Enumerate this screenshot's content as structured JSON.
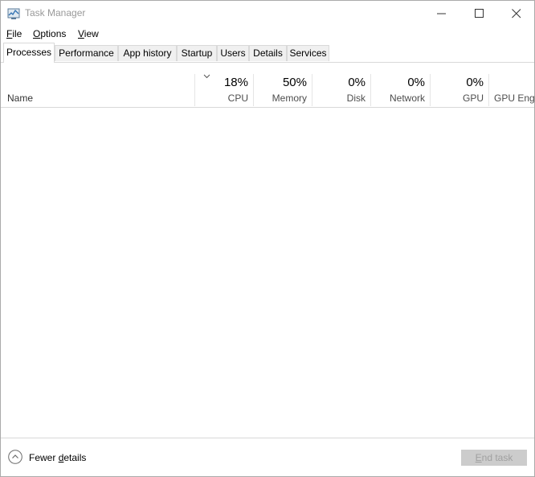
{
  "window": {
    "title": "Task Manager",
    "icon": "task-manager-icon"
  },
  "menu": {
    "file": {
      "accel": "F",
      "rest": "ile"
    },
    "options": {
      "accel": "O",
      "rest": "ptions"
    },
    "view": {
      "accel": "V",
      "rest": "iew"
    }
  },
  "tabs": [
    {
      "label": "Processes",
      "active": true
    },
    {
      "label": "Performance",
      "active": false
    },
    {
      "label": "App history",
      "active": false
    },
    {
      "label": "Startup",
      "active": false
    },
    {
      "label": "Users",
      "active": false
    },
    {
      "label": "Details",
      "active": false
    },
    {
      "label": "Services",
      "active": false
    }
  ],
  "columns": {
    "name": "Name",
    "cpu": {
      "value": "18%",
      "label": "CPU"
    },
    "memory": {
      "value": "50%",
      "label": "Memory"
    },
    "disk": {
      "value": "0%",
      "label": "Disk"
    },
    "network": {
      "value": "0%",
      "label": "Network"
    },
    "gpu": {
      "value": "0%",
      "label": "GPU"
    },
    "gpu_engine": {
      "label": "GPU Engine"
    }
  },
  "footer": {
    "fewer_details": {
      "prefix": "Fewer ",
      "accel": "d",
      "rest": "etails"
    },
    "end_task": {
      "accel": "E",
      "rest": "nd task"
    }
  },
  "colors": {
    "accent_border": "#d9d9d9",
    "disabled_button": "#cccccc"
  }
}
